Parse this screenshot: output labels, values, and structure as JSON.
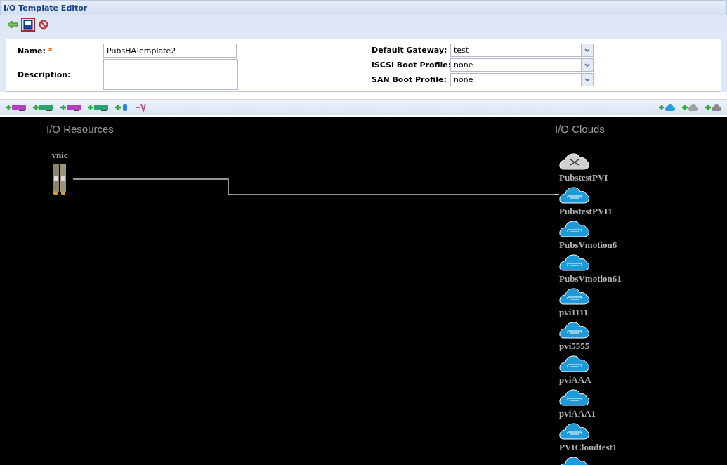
{
  "window": {
    "title": "I/O Template Editor"
  },
  "toolbar": [
    {
      "kind": "back"
    },
    {
      "kind": "save",
      "selected": true
    },
    {
      "kind": "cancel"
    }
  ],
  "form": {
    "left": [
      {
        "label": "Name:",
        "required_mark": "*",
        "value": "PubsHATemplate2",
        "kind": "text"
      },
      {
        "label": "Description:",
        "kind": "area"
      }
    ],
    "right": [
      {
        "label": "Default Gateway:",
        "value": "test"
      },
      {
        "label": "iSCSI Boot Profile:",
        "value": "none"
      },
      {
        "label": "SAN Boot Profile:",
        "value": "none"
      }
    ]
  },
  "resource_tools": [
    {
      "color": "#b040c0"
    },
    {
      "color": "#30a070"
    },
    {
      "color": "#b040c0"
    },
    {
      "color": "#30a070"
    }
  ],
  "cloud_tools": [
    {
      "color": "#2a9ee0"
    },
    {
      "color": "#a0a0a0"
    },
    {
      "color": "#888888"
    }
  ],
  "canvas": {
    "resources_title": "I/O Resources",
    "clouds_title": "I/O Clouds",
    "resources": [
      {
        "name": "vnic"
      }
    ],
    "clouds": [
      {
        "kind": "network",
        "connected": false
      },
      {
        "kind": "pvi",
        "name": "PubstestPVI",
        "connected": true
      },
      {
        "kind": "pvi",
        "name": "PubstestPVI1",
        "connected": false
      },
      {
        "kind": "pvi",
        "name": "PubsVmotion6",
        "connected": false
      },
      {
        "kind": "pvi",
        "name": "PubsVmotion61",
        "connected": false
      },
      {
        "kind": "pvi",
        "name": "pvi1111",
        "connected": false
      },
      {
        "kind": "pvi",
        "name": "pvi5555",
        "connected": false
      },
      {
        "kind": "pvi",
        "name": "pviAAA",
        "connected": false
      },
      {
        "kind": "pvi",
        "name": "pviAAA1",
        "connected": false
      },
      {
        "kind": "pvi",
        "name": "PVICloudtest1",
        "connected": false
      }
    ]
  }
}
